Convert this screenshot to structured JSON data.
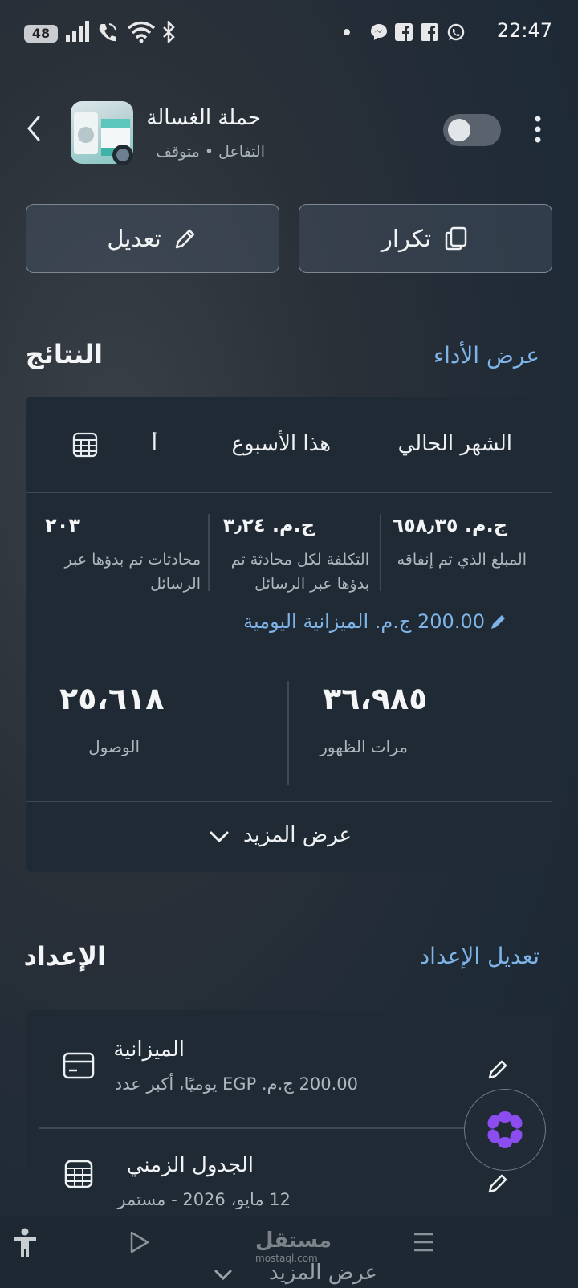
{
  "status_bar": {
    "battery": "48",
    "time": "22:47",
    "icons": [
      "signal-icon",
      "volte-icon",
      "wifi-icon",
      "bluetooth-icon",
      "dot-icon",
      "messenger-icon",
      "facebook-icon",
      "facebook-icon",
      "whatsapp-icon"
    ]
  },
  "header": {
    "title": "حملة الغسالة",
    "subtitle": "التفاعل • متوقف"
  },
  "actions": {
    "edit_label": "تعديل",
    "duplicate_label": "تكرار"
  },
  "results": {
    "title": "النتائج",
    "link": "عرض الأداء",
    "tabs": [
      "الشهر الحالي",
      "هذا الأسبوع",
      "أ"
    ],
    "metrics": [
      {
        "value": "ج.م. ٦٥٨٫٣٥",
        "label": "المبلغ الذي تم إنفاقه"
      },
      {
        "value": "ج.م. ٣٫٢٤",
        "label": "التكلفة لكل محادثة تم بدؤها عبر الرسائل"
      },
      {
        "value": "٢٠٣",
        "label": "محادثات تم بدؤها عبر الرسائل"
      }
    ],
    "daily_budget": "200.00 ج.م. الميزانية اليومية",
    "impressions": {
      "value": "٣٦،٩٨٥",
      "label": "مرات الظهور"
    },
    "reach": {
      "value": "٢٥،٦١٨",
      "label": "الوصول"
    },
    "more_label": "عرض المزيد"
  },
  "setup": {
    "title": "الإعداد",
    "link": "تعديل الإعداد",
    "budget": {
      "title": "الميزانية",
      "detail": "200.00 ج.م. EGP يوميًا، أكبر عدد"
    },
    "schedule": {
      "title": "الجدول الزمني",
      "detail": "12 مايو، 2026 - مستمر"
    },
    "more_label": "عرض المزيد"
  },
  "watermark": {
    "text": "مستقل",
    "sub": "mostaql.com"
  },
  "colors": {
    "accent": "#7fb4e8",
    "card": "#1f2a34",
    "fab_petals": "#8b4cf0"
  }
}
